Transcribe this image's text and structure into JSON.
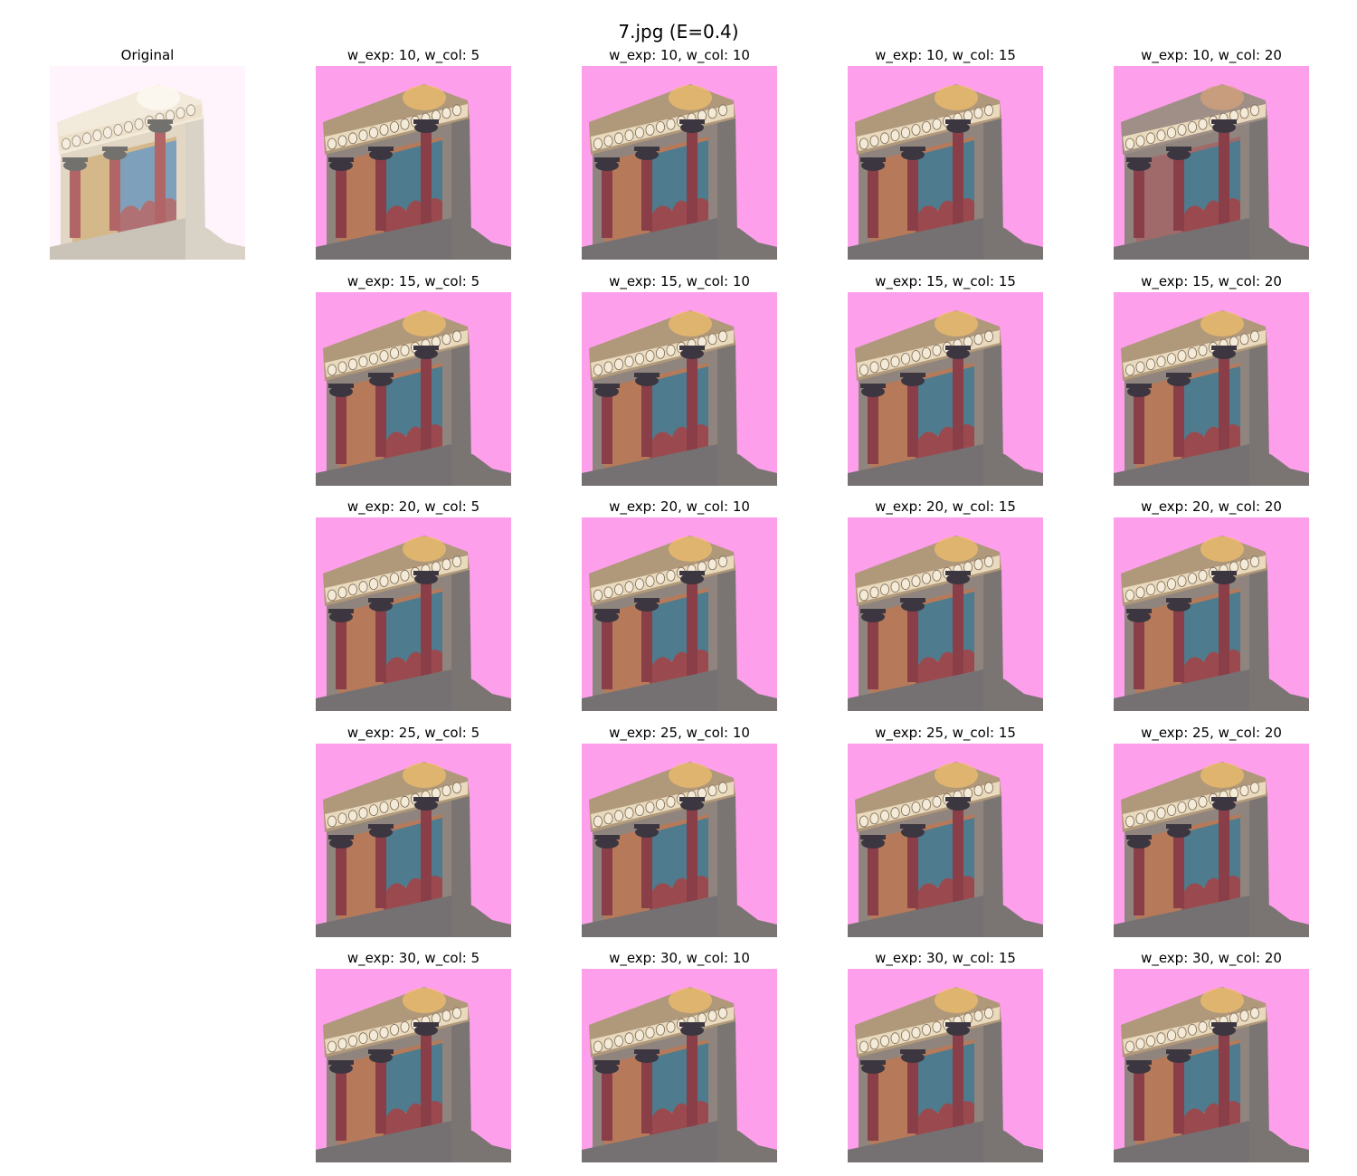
{
  "figure": {
    "title": "7.jpg (E=0.4)"
  },
  "original": {
    "label": "Original",
    "scene": "original-photo"
  },
  "colors": {
    "pink_bg": "#fe9fec",
    "original_bg": "#fff0fb"
  },
  "grid": {
    "rows": [
      [
        "w_exp: 10, w_col: 5",
        "w_exp: 10, w_col: 10",
        "w_exp: 10, w_col: 15",
        "w_exp: 10, w_col: 20"
      ],
      [
        "w_exp: 15, w_col: 5",
        "w_exp: 15, w_col: 10",
        "w_exp: 15, w_col: 15",
        "w_exp: 15, w_col: 20"
      ],
      [
        "w_exp: 20, w_col: 5",
        "w_exp: 20, w_col: 10",
        "w_exp: 20, w_col: 15",
        "w_exp: 20, w_col: 20"
      ],
      [
        "w_exp: 25, w_col: 5",
        "w_exp: 25, w_col: 10",
        "w_exp: 25, w_col: 15",
        "w_exp: 25, w_col: 20"
      ],
      [
        "w_exp: 30, w_col: 5",
        "w_exp: 30, w_col: 10",
        "w_exp: 30, w_col: 15",
        "w_exp: 30, w_col: 20"
      ]
    ]
  }
}
